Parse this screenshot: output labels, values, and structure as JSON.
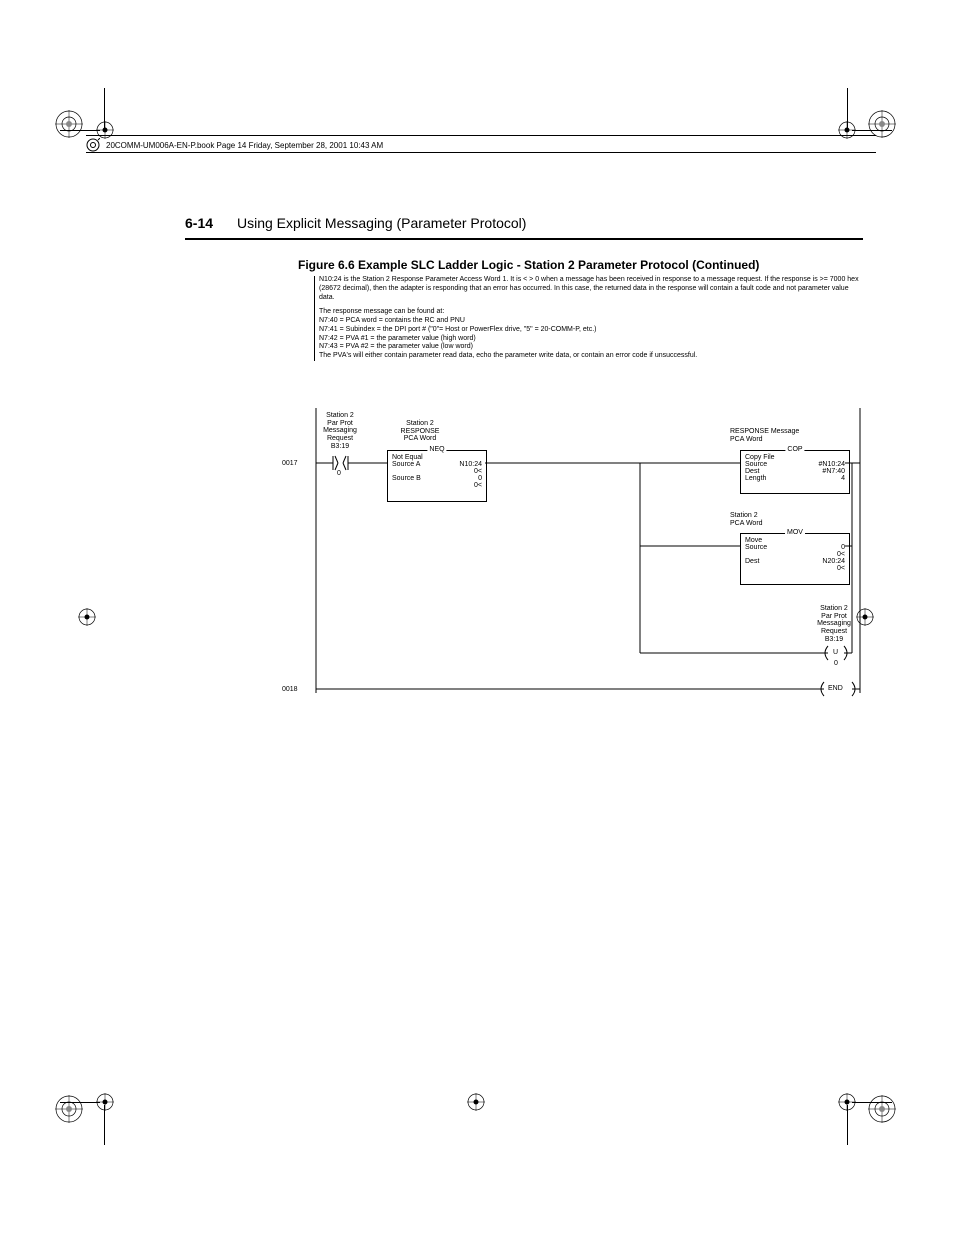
{
  "header": {
    "file_info": "20COMM-UM006A-EN-P.book  Page 14  Friday, September 28, 2001  10:43 AM"
  },
  "page": {
    "number": "6-14",
    "section_title": "Using Explicit Messaging (Parameter Protocol)"
  },
  "figure": {
    "title": "Figure 6.6    Example SLC Ladder Logic - Station 2 Parameter Protocol (Continued)"
  },
  "desc": {
    "p1": "N10:24 is the Station 2 Response Parameter Access Word 1.  It is < > 0 when a message has been received in response to a message request.  If the response is >= 7000 hex (28672 decimal), then the adapter is responding that an error has occurred.  In this case, the returned data in the response will contain a fault code and not parameter value data.",
    "p2a": "The response message can be found at:",
    "p2b": "N7:40 = PCA word = contains the RC and PNU",
    "p2c": "N7:41 = Subindex = the DPI port # (\"0\"= Host or PowerFlex drive, \"5\" = 20-COMM-P, etc.)",
    "p2d": "N7:42 = PVA #1 = the parameter value (high word)",
    "p2e": "N7:43 = PVA #2 = the parameter value (low word)",
    "p2f": "The PVA's will either contain parameter read data, echo the parameter write data, or contain an error code if unsuccessful."
  },
  "ladder": {
    "rung1": "0017",
    "rung2": "0018",
    "contact1": {
      "l1": "Station 2",
      "l2": "Par Prot",
      "l3": "Messaging",
      "l4": "Request",
      "addr": "B3:19",
      "bit": "0"
    },
    "neq": {
      "top1": "Station 2",
      "top2": "RESPONSE",
      "top3": "PCA Word",
      "title": "NEQ",
      "name": "Not Equal",
      "srcA_lbl": "Source A",
      "srcA_val": "N10:24",
      "srcA_sub": "0<",
      "srcB_lbl": "Source B",
      "srcB_val": "0",
      "srcB_sub": "0<"
    },
    "cop": {
      "top1": "RESPONSE Message",
      "top2": "PCA Word",
      "title": "COP",
      "name": "Copy File",
      "src_lbl": "Source",
      "src_val": "#N10:24",
      "dst_lbl": "Dest",
      "dst_val": "#N7:40",
      "len_lbl": "Length",
      "len_val": "4"
    },
    "mov": {
      "top1": "Station 2",
      "top2": "PCA Word",
      "title": "MOV",
      "name": "Move",
      "src_lbl": "Source",
      "src_val": "0",
      "src_sub": "0<",
      "dst_lbl": "Dest",
      "dst_val": "N20:24",
      "dst_sub": "0<"
    },
    "coil": {
      "l1": "Station 2",
      "l2": "Par Prot",
      "l3": "Messaging",
      "l4": "Request",
      "addr": "B3:19",
      "sym": "U",
      "bit": "0"
    },
    "end": "END"
  }
}
